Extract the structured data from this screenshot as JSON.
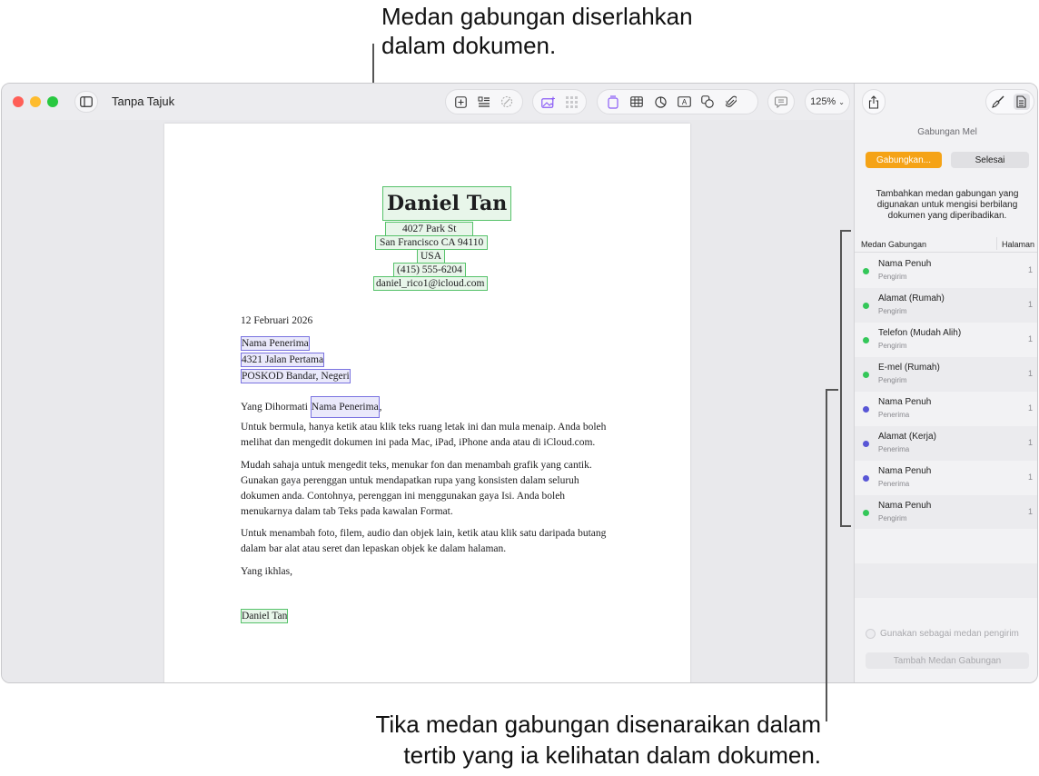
{
  "callouts": {
    "top_line1": "Medan gabungan diserlahkan",
    "top_line2": "dalam dokumen.",
    "bottom_line1": "Tika medan gabungan disenaraikan dalam",
    "bottom_line2": "tertib yang ia kelihatan dalam dokumen."
  },
  "window": {
    "title": "Tanpa Tajuk",
    "zoom": "125%"
  },
  "colors": {
    "sender_field": "#34c759",
    "recipient_field": "#5856d6",
    "merge_button": "#f5a316"
  },
  "document": {
    "sender_name": "Daniel Tan",
    "sender_street": "4027 Park St",
    "sender_city": "San Francisco CA 94110",
    "sender_country": "USA",
    "sender_phone": "(415) 555-6204",
    "sender_email": "daniel_rico1@icloud.com",
    "date": "12 Februari 2026",
    "recipient_name": "Nama Penerima",
    "recipient_street": "4321 Jalan Pertama",
    "recipient_postcode": "POSKOD Bandar, Negeri",
    "greeting_prefix": "Yang Dihormati",
    "greeting_field": "Nama Penerima",
    "greeting_suffix": ",",
    "para1": "Untuk bermula, hanya ketik atau klik teks ruang letak ini dan mula menaip. Anda boleh melihat dan mengedit dokumen ini pada Mac, iPad, iPhone anda atau di iCloud.com.",
    "para2": "Mudah sahaja untuk mengedit teks, menukar fon dan menambah grafik yang cantik. Gunakan gaya perenggan untuk mendapatkan rupa yang konsisten dalam seluruh dokumen anda. Contohnya, perenggan ini menggunakan gaya Isi. Anda boleh menukarnya dalam tab Teks pada kawalan Format.",
    "para3": "Untuk menambah foto, filem, audio dan objek lain, ketik atau klik satu daripada butang dalam bar alat atau seret dan lepaskan objek ke dalam halaman.",
    "closing": "Yang ikhlas,",
    "signature": "Daniel Tan"
  },
  "inspector": {
    "heading": "Gabungan Mel",
    "merge_button": "Gabungkan...",
    "done_button": "Selesai",
    "description": "Tambahkan medan gabungan yang digunakan untuk mengisi berbilang dokumen yang diperibadikan.",
    "col_field": "Medan Gabungan",
    "col_page": "Halaman",
    "fields": [
      {
        "name": "Nama Penuh",
        "source": "Pengirim",
        "page": "1",
        "kind": "sender"
      },
      {
        "name": "Alamat (Rumah)",
        "source": "Pengirim",
        "page": "1",
        "kind": "sender"
      },
      {
        "name": "Telefon (Mudah Alih)",
        "source": "Pengirim",
        "page": "1",
        "kind": "sender"
      },
      {
        "name": "E-mel (Rumah)",
        "source": "Pengirim",
        "page": "1",
        "kind": "sender"
      },
      {
        "name": "Nama Penuh",
        "source": "Penerima",
        "page": "1",
        "kind": "recipient"
      },
      {
        "name": "Alamat (Kerja)",
        "source": "Penerima",
        "page": "1",
        "kind": "recipient"
      },
      {
        "name": "Nama Penuh",
        "source": "Penerima",
        "page": "1",
        "kind": "recipient"
      },
      {
        "name": "Nama Penuh",
        "source": "Pengirim",
        "page": "1",
        "kind": "sender"
      }
    ],
    "use_as_sender": "Gunakan sebagai medan pengirim",
    "add_field_button": "Tambah Medan Gabungan"
  }
}
